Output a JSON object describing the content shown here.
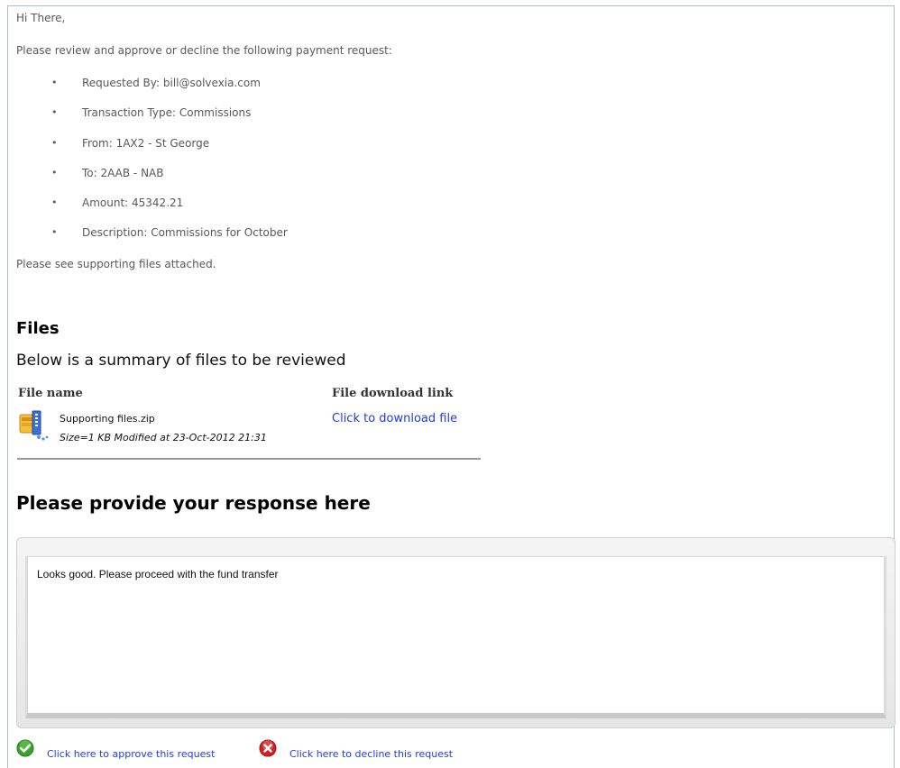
{
  "email": {
    "greeting": "Hi There,",
    "intro": "Please review and approve or decline the following payment request:",
    "details": [
      "Requested By:  bill@solvexia.com",
      "Transaction Type: Commissions",
      "From: 1AX2 - St George",
      "To: 2AAB - NAB",
      "Amount: 45342.21",
      "Description: Commissions for October"
    ],
    "bullet": "•",
    "supporting_note": "Please see supporting files attached."
  },
  "files": {
    "title": "Files",
    "subtitle": "Below is a summary of files to be reviewed",
    "col_name": "File name",
    "col_link": "File download link",
    "items": [
      {
        "icon": "zip-file-icon",
        "name": "Supporting files.zip",
        "meta": "Size=1 KB Modified at 23-Oct-2012 21:31",
        "link": "Click to download file"
      }
    ]
  },
  "response": {
    "title": "Please provide your response here",
    "text": "Looks good. Please proceed with the fund transfer"
  },
  "actions": {
    "approve": {
      "icon": "green-checkmark-icon",
      "label": "Click here to approve this request"
    },
    "decline": {
      "icon": "red-x-icon",
      "label": "Click here to decline this request"
    }
  },
  "colors": {
    "link": "#1f3fe0",
    "body_text": "#595959",
    "frame_border": "#a9bdd6",
    "approve_green": "#3aa12b",
    "decline_red": "#d32222"
  }
}
